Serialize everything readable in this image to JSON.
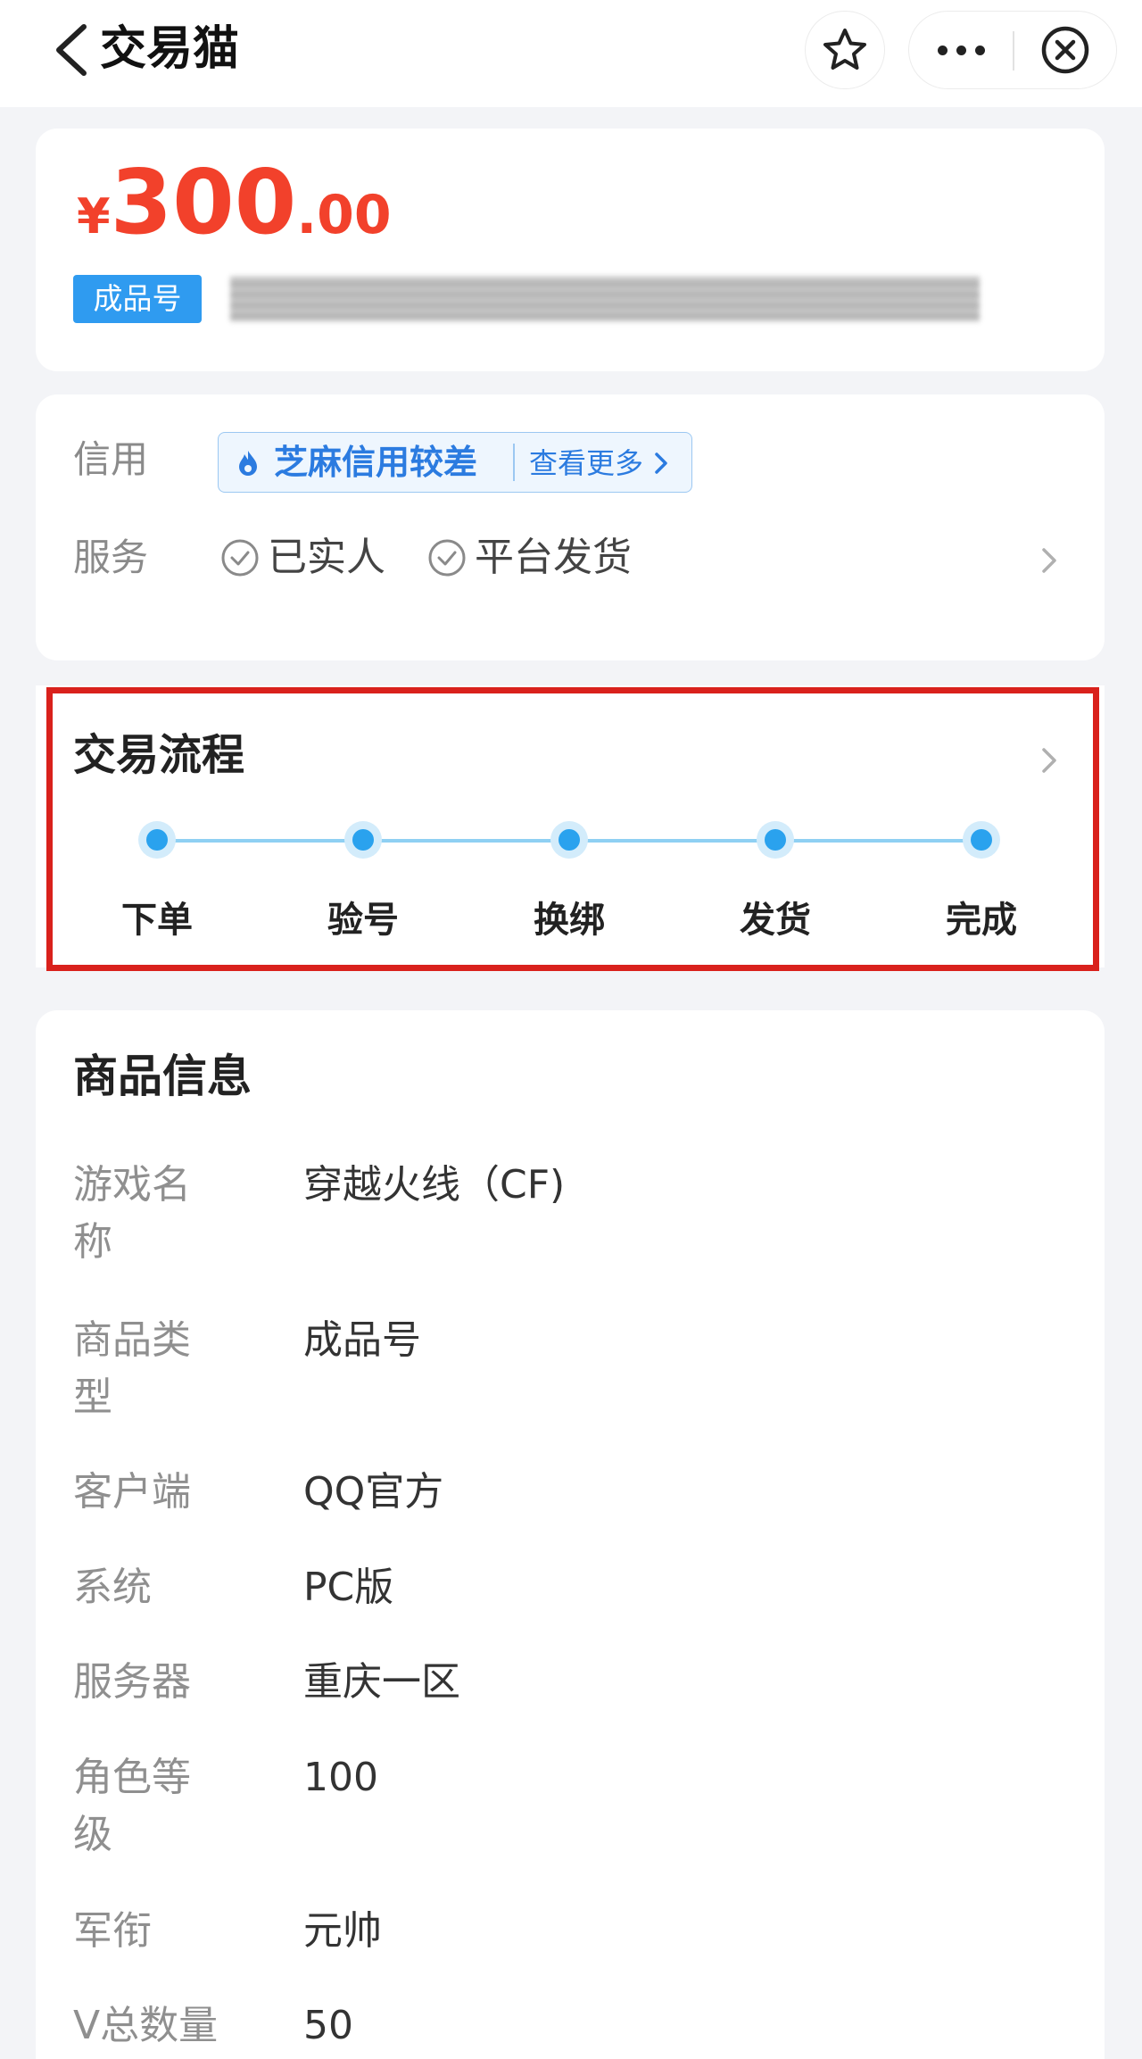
{
  "header": {
    "title": "交易猫"
  },
  "price": {
    "currency": "¥",
    "integer": "300",
    "decimal": ".00",
    "badge": "成品号"
  },
  "credit": {
    "label": "信用",
    "rating": "芝麻信用较差",
    "more": "查看更多"
  },
  "service": {
    "label": "服务",
    "items": [
      "已实人",
      "平台发货"
    ]
  },
  "process": {
    "title": "交易流程",
    "steps": [
      "下单",
      "验号",
      "换绑",
      "发货",
      "完成"
    ]
  },
  "product_info": {
    "title": "商品信息",
    "rows": [
      {
        "label": "游戏名称",
        "value": "穿越火线（CF)"
      },
      {
        "label": "商品类型",
        "value": "成品号"
      },
      {
        "label": "客户端",
        "value": "QQ官方"
      },
      {
        "label": "系统",
        "value": "PC版"
      },
      {
        "label": "服务器",
        "value": "重庆一区"
      },
      {
        "label": "角色等级",
        "value": "100"
      },
      {
        "label": "军衔",
        "value": "元帅"
      },
      {
        "label": "V总数量",
        "value": "50"
      }
    ]
  },
  "colors": {
    "price_red": "#f2412b",
    "badge_blue": "#2f9bf0",
    "credit_blue": "#2b7be0",
    "step_blue": "#2aa2ee",
    "highlight_red": "#d9211c"
  }
}
